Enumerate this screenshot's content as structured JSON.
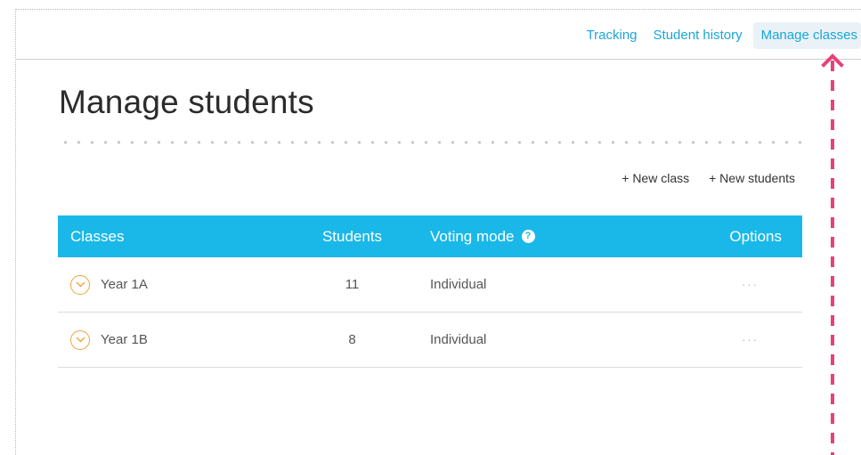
{
  "nav": {
    "items": [
      {
        "label": "Tracking"
      },
      {
        "label": "Student history"
      },
      {
        "label": "Manage classes"
      }
    ]
  },
  "page": {
    "title": "Manage students"
  },
  "actions": {
    "new_class": "+ New class",
    "new_students": "+ New students"
  },
  "table": {
    "headers": {
      "classes": "Classes",
      "students": "Students",
      "voting_mode": "Voting mode",
      "options": "Options"
    },
    "rows": [
      {
        "class": "Year 1A",
        "students": "11",
        "voting_mode": "Individual",
        "options": "···"
      },
      {
        "class": "Year 1B",
        "students": "8",
        "voting_mode": "Individual",
        "options": "···"
      }
    ]
  },
  "colors": {
    "accent": "#1ab8e8",
    "link": "#1aa6d8",
    "expand": "#f3a13a",
    "annotation_arrow": "#e8407a"
  },
  "icons": {
    "help": "question-circle-icon",
    "expand": "chevron-down-circle-icon",
    "options": "ellipsis-icon",
    "annotation": "dashed-arrow-up-icon"
  }
}
